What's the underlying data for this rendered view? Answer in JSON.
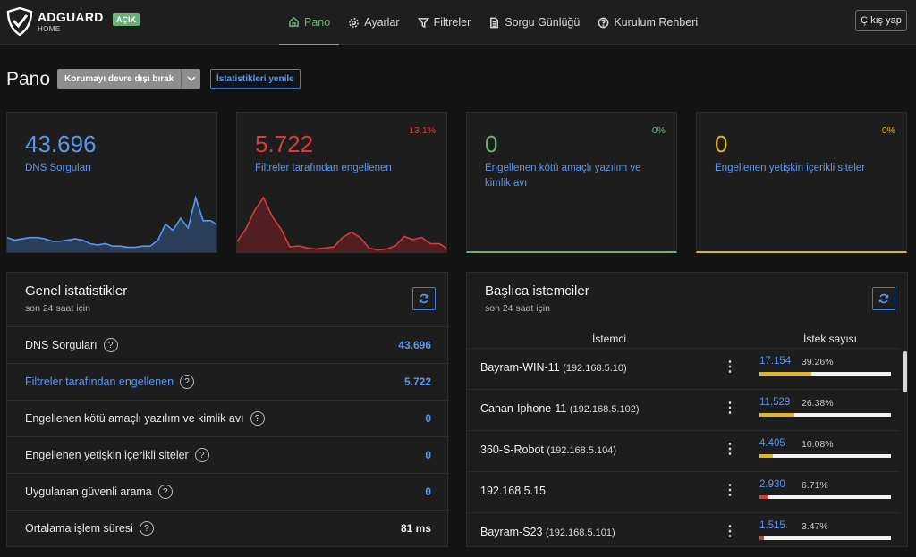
{
  "header": {
    "brand": "ADGUARD",
    "brand_sub": "HOME",
    "status_badge": "AÇIK",
    "nav": [
      {
        "label": "Pano",
        "icon": "home-icon",
        "active": true
      },
      {
        "label": "Ayarlar",
        "icon": "gear-icon",
        "active": false
      },
      {
        "label": "Filtreler",
        "icon": "filter-icon",
        "active": false
      },
      {
        "label": "Sorgu Günlüğü",
        "icon": "document-icon",
        "active": false
      },
      {
        "label": "Kurulum Rehberi",
        "icon": "help-icon",
        "active": false
      }
    ],
    "logout": "Çıkış yap"
  },
  "page": {
    "title": "Pano",
    "disable_button": "Korumayı devre dışı bırak",
    "refresh_button": "İstatistikleri yenile"
  },
  "stat_cards": [
    {
      "value": "43.696",
      "label": "DNS Sorguları",
      "percent": "",
      "color": "#5a97ef"
    },
    {
      "value": "5.722",
      "label": "Filtreler tarafından engellenen",
      "percent": "13.1%",
      "color": "#d93b3b"
    },
    {
      "value": "0",
      "label": "Engellenen kötü amaçlı yazılım ve kimlik avı",
      "percent": "0%",
      "color": "#67b279"
    },
    {
      "value": "0",
      "label": "Engellenen yetişkin içerikli siteler",
      "percent": "0%",
      "color": "#e0b32a"
    }
  ],
  "sparklines": {
    "dns": [
      12,
      10,
      11,
      12,
      12,
      11,
      9,
      9,
      10,
      11,
      10,
      7,
      6,
      7,
      5,
      5,
      4,
      4,
      5,
      5,
      10,
      23,
      18,
      28,
      20,
      45,
      26,
      26,
      22
    ],
    "blocked": [
      10,
      22,
      40,
      52,
      34,
      22,
      5,
      6,
      4,
      3,
      4,
      5,
      14,
      19,
      14,
      4,
      2,
      3,
      6,
      15,
      12,
      14,
      8,
      8,
      3
    ]
  },
  "general_stats": {
    "title": "Genel istatistikler",
    "subtitle": "son 24 saat için",
    "rows": [
      {
        "label": "DNS Sorguları",
        "value": "43.696"
      },
      {
        "label": "Filtreler tarafından engellenen",
        "value": "5.722"
      },
      {
        "label": "Engellenen kötü amaçlı yazılım ve kimlik avı",
        "value": "0"
      },
      {
        "label": "Engellenen yetişkin içerikli siteler",
        "value": "0"
      },
      {
        "label": "Uygulanan güvenli arama",
        "value": "0"
      },
      {
        "label": "Ortalama işlem süresi",
        "value": "81 ms"
      }
    ]
  },
  "top_clients": {
    "title": "Başlıca istemciler",
    "subtitle": "son 24 saat için",
    "col_client": "İstemci",
    "col_requests": "İstek sayısı",
    "rows": [
      {
        "name": "Bayram-WIN-11",
        "ip": "(192.168.5.10)",
        "count": "17.154",
        "percent": "39.26%",
        "share": 39.26,
        "bar_color": "#e0b32a"
      },
      {
        "name": "Canan-Iphone-11",
        "ip": "(192.168.5.102)",
        "count": "11.529",
        "percent": "26.38%",
        "share": 26.38,
        "bar_color": "#e0b32a"
      },
      {
        "name": "360-S-Robot",
        "ip": "(192.168.5.104)",
        "count": "4.405",
        "percent": "10.08%",
        "share": 10.08,
        "bar_color": "#e0b32a"
      },
      {
        "name": "192.168.5.15",
        "ip": "",
        "count": "2.930",
        "percent": "6.71%",
        "share": 6.71,
        "bar_color": "#d93b3b"
      },
      {
        "name": "Bayram-S23",
        "ip": "(192.168.5.101)",
        "count": "1.515",
        "percent": "3.47%",
        "share": 3.47,
        "bar_color": "#d93b3b"
      }
    ]
  }
}
